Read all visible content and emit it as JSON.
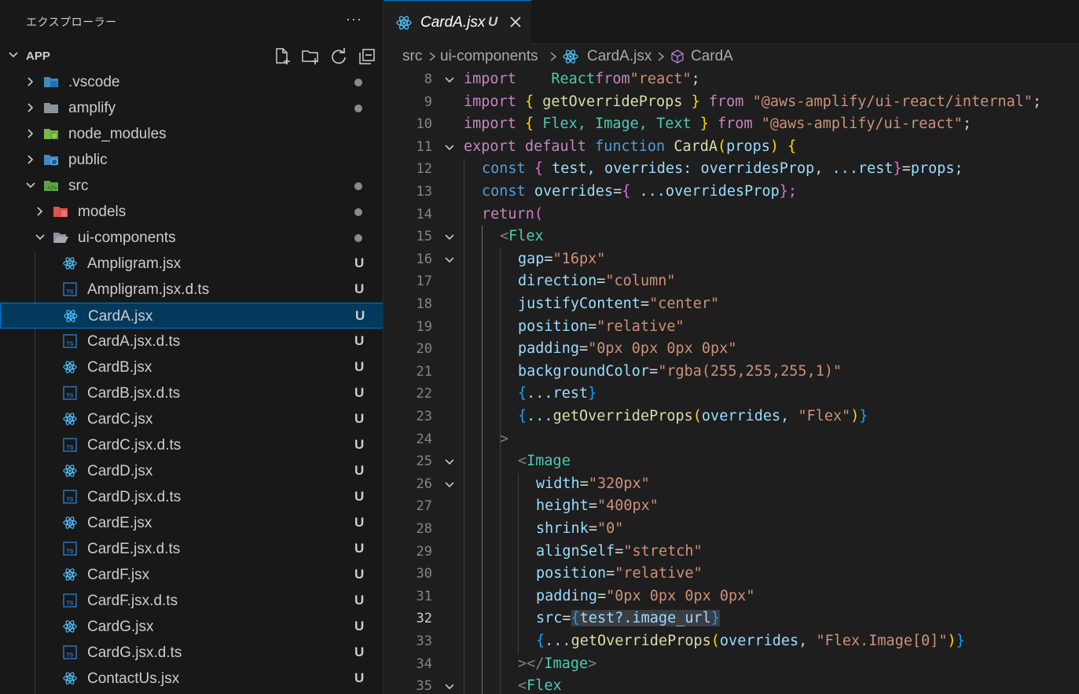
{
  "sidebar": {
    "title": "エクスプローラー",
    "more": "···",
    "section_title": "APP",
    "actions": [
      "new-file-icon",
      "new-folder-icon",
      "refresh-icon",
      "collapse-all-icon"
    ],
    "items": [
      {
        "label": ".vscode",
        "depth": 0,
        "type": "folder",
        "expanded": false,
        "status": "dot",
        "icon": "vscode-folder-icon"
      },
      {
        "label": "amplify",
        "depth": 0,
        "type": "folder",
        "expanded": false,
        "status": "dot",
        "icon": "folder-icon"
      },
      {
        "label": "node_modules",
        "depth": 0,
        "type": "folder",
        "expanded": false,
        "status": "",
        "icon": "node-folder-icon"
      },
      {
        "label": "public",
        "depth": 0,
        "type": "folder",
        "expanded": false,
        "status": "",
        "icon": "public-folder-icon"
      },
      {
        "label": "src",
        "depth": 0,
        "type": "folder",
        "expanded": true,
        "status": "dot",
        "icon": "src-folder-icon"
      },
      {
        "label": "models",
        "depth": 1,
        "type": "folder",
        "expanded": false,
        "status": "dot",
        "icon": "models-folder-icon"
      },
      {
        "label": "ui-components",
        "depth": 1,
        "type": "folder",
        "expanded": true,
        "status": "dot",
        "icon": "open-folder-icon"
      },
      {
        "label": "Ampligram.jsx",
        "depth": 2,
        "type": "jsx",
        "status": "U"
      },
      {
        "label": "Ampligram.jsx.d.ts",
        "depth": 2,
        "type": "ts",
        "status": "U"
      },
      {
        "label": "CardA.jsx",
        "depth": 2,
        "type": "jsx",
        "status": "U",
        "selected": true
      },
      {
        "label": "CardA.jsx.d.ts",
        "depth": 2,
        "type": "ts",
        "status": "U"
      },
      {
        "label": "CardB.jsx",
        "depth": 2,
        "type": "jsx",
        "status": "U"
      },
      {
        "label": "CardB.jsx.d.ts",
        "depth": 2,
        "type": "ts",
        "status": "U"
      },
      {
        "label": "CardC.jsx",
        "depth": 2,
        "type": "jsx",
        "status": "U"
      },
      {
        "label": "CardC.jsx.d.ts",
        "depth": 2,
        "type": "ts",
        "status": "U"
      },
      {
        "label": "CardD.jsx",
        "depth": 2,
        "type": "jsx",
        "status": "U"
      },
      {
        "label": "CardD.jsx.d.ts",
        "depth": 2,
        "type": "ts",
        "status": "U"
      },
      {
        "label": "CardE.jsx",
        "depth": 2,
        "type": "jsx",
        "status": "U"
      },
      {
        "label": "CardE.jsx.d.ts",
        "depth": 2,
        "type": "ts",
        "status": "U"
      },
      {
        "label": "CardF.jsx",
        "depth": 2,
        "type": "jsx",
        "status": "U"
      },
      {
        "label": "CardF.jsx.d.ts",
        "depth": 2,
        "type": "ts",
        "status": "U"
      },
      {
        "label": "CardG.jsx",
        "depth": 2,
        "type": "jsx",
        "status": "U"
      },
      {
        "label": "CardG.jsx.d.ts",
        "depth": 2,
        "type": "ts",
        "status": "U"
      },
      {
        "label": "ContactUs.jsx",
        "depth": 2,
        "type": "jsx",
        "status": "U"
      }
    ]
  },
  "tab": {
    "label": "CardA.jsx",
    "badge": "U"
  },
  "breadcrumb": {
    "part1": "src",
    "part2": "ui-components",
    "part3": "CardA.jsx",
    "part4": "CardA"
  },
  "colors": {
    "accent": "#0078d4",
    "selection": "#04395e",
    "react": "#4fc1ff",
    "ts": "#3178c6"
  },
  "code": {
    "active_line": "32",
    "lines": [
      {
        "n": "8",
        "fold": true,
        "t": [
          [
            "kw",
            "import"
          ],
          [
            "",
            "  "
          ],
          [
            "cls",
            "React"
          ],
          [
            "",
            ""
          ],
          [
            "kw",
            "from"
          ],
          [
            "",
            ""
          ],
          [
            "str",
            "\"react\""
          ],
          [
            "",
            ";"
          ]
        ]
      },
      {
        "n": "9",
        "fold": false,
        "t": [
          [
            "kw",
            "import"
          ],
          [
            "b1",
            "{"
          ],
          [
            "fn",
            "getOverrideProps"
          ],
          [
            "b1",
            "}"
          ],
          [
            "kw",
            "from"
          ],
          [
            "str",
            "\"@aws-amplify/ui-react/internal\""
          ],
          [
            "",
            ";"
          ]
        ]
      },
      {
        "n": "10",
        "fold": false,
        "t": [
          [
            "kw",
            "import"
          ],
          [
            "b1",
            "{"
          ],
          [
            "cls",
            "Flex,"
          ],
          [
            "cls",
            "Image,"
          ],
          [
            "cls",
            "Text"
          ],
          [
            "b1",
            "}"
          ],
          [
            "kw",
            "from"
          ],
          [
            "str",
            "\"@aws-amplify/ui-react\""
          ],
          [
            "",
            ";"
          ]
        ]
      },
      {
        "n": "11",
        "fold": true,
        "t": [
          [
            "kw",
            "export"
          ],
          [
            "kw",
            "default"
          ],
          [
            "kb",
            "function"
          ],
          [
            "fn",
            "CardA"
          ],
          [
            "b1",
            "("
          ],
          [
            "var",
            "props"
          ],
          [
            "b1",
            ")"
          ],
          [
            "b1",
            "{"
          ]
        ]
      },
      {
        "n": "12",
        "fold": false,
        "t": [
          [
            "kb",
            "const"
          ],
          [
            "b2",
            "{"
          ],
          [
            "var",
            "test,"
          ],
          [
            "var",
            "overrides:"
          ],
          [
            "var",
            "overridesProp,"
          ],
          [
            "var",
            "...rest"
          ],
          [
            "b2",
            "}"
          ],
          [
            "",
            "="
          ],
          [
            "var",
            "props;"
          ]
        ]
      },
      {
        "n": "13",
        "fold": false,
        "t": [
          [
            "kb",
            "const"
          ],
          [
            "var",
            "overrides"
          ],
          [
            "",
            "="
          ],
          [
            "b2",
            "{"
          ],
          [
            "var",
            "...overridesProp"
          ],
          [
            "b2",
            "};"
          ]
        ]
      },
      {
        "n": "14",
        "fold": false,
        "t": [
          [
            "kw",
            "return"
          ],
          [
            "b2",
            "("
          ]
        ]
      },
      {
        "n": "15",
        "fold": true,
        "t": [
          [
            "tg",
            "<"
          ],
          [
            "cls",
            "Flex"
          ]
        ]
      },
      {
        "n": "16",
        "fold": true,
        "t": [
          [
            "var",
            "gap"
          ],
          [
            "",
            "="
          ],
          [
            "str",
            "\"16px\""
          ]
        ]
      },
      {
        "n": "17",
        "fold": false,
        "t": [
          [
            "var",
            "direction"
          ],
          [
            "",
            "="
          ],
          [
            "str",
            "\"column\""
          ]
        ]
      },
      {
        "n": "18",
        "fold": false,
        "t": [
          [
            "var",
            "justifyContent"
          ],
          [
            "",
            "="
          ],
          [
            "str",
            "\"center\""
          ]
        ]
      },
      {
        "n": "19",
        "fold": false,
        "t": [
          [
            "var",
            "position"
          ],
          [
            "",
            "="
          ],
          [
            "str",
            "\"relative\""
          ]
        ]
      },
      {
        "n": "20",
        "fold": false,
        "t": [
          [
            "var",
            "padding"
          ],
          [
            "",
            "="
          ],
          [
            "str",
            "\"0px 0px 0px 0px\""
          ]
        ]
      },
      {
        "n": "21",
        "fold": false,
        "t": [
          [
            "var",
            "backgroundColor"
          ],
          [
            "",
            "="
          ],
          [
            "str",
            "\"rgba(255,255,255,1)\""
          ]
        ]
      },
      {
        "n": "22",
        "fold": false,
        "t": [
          [
            "b3",
            "{"
          ],
          [
            "var",
            "...rest"
          ],
          [
            "b3",
            "}"
          ]
        ]
      },
      {
        "n": "23",
        "fold": false,
        "t": [
          [
            "b3",
            "{"
          ],
          [
            "var",
            "..."
          ],
          [
            "fn",
            "getOverrideProps"
          ],
          [
            "b1",
            "("
          ],
          [
            "var",
            "overrides,"
          ],
          [
            "str",
            "\"Flex\""
          ],
          [
            "b1",
            ")"
          ],
          [
            "b3",
            "}"
          ]
        ]
      },
      {
        "n": "24",
        "fold": false,
        "t": [
          [
            "tg",
            ">"
          ]
        ]
      },
      {
        "n": "25",
        "fold": true,
        "t": [
          [
            "tg",
            "<"
          ],
          [
            "cls",
            "Image"
          ]
        ]
      },
      {
        "n": "26",
        "fold": true,
        "t": [
          [
            "var",
            "width"
          ],
          [
            "",
            "="
          ],
          [
            "str",
            "\"320px\""
          ]
        ]
      },
      {
        "n": "27",
        "fold": false,
        "t": [
          [
            "var",
            "height"
          ],
          [
            "",
            "="
          ],
          [
            "str",
            "\"400px\""
          ]
        ]
      },
      {
        "n": "28",
        "fold": false,
        "t": [
          [
            "var",
            "shrink"
          ],
          [
            "",
            "="
          ],
          [
            "str",
            "\"0\""
          ]
        ]
      },
      {
        "n": "29",
        "fold": false,
        "t": [
          [
            "var",
            "alignSelf"
          ],
          [
            "",
            "="
          ],
          [
            "str",
            "\"stretch\""
          ]
        ]
      },
      {
        "n": "30",
        "fold": false,
        "t": [
          [
            "var",
            "position"
          ],
          [
            "",
            "="
          ],
          [
            "str",
            "\"relative\""
          ]
        ]
      },
      {
        "n": "31",
        "fold": false,
        "t": [
          [
            "var",
            "padding"
          ],
          [
            "",
            "="
          ],
          [
            "str",
            "\"0px 0px 0px 0px\""
          ]
        ]
      },
      {
        "n": "32",
        "fold": false,
        "t": [
          [
            "var",
            "src"
          ],
          [
            "",
            "="
          ],
          [
            "b3",
            "{"
          ],
          [
            "var",
            "test?.image_url"
          ],
          [
            "b3",
            "}"
          ]
        ]
      },
      {
        "n": "33",
        "fold": false,
        "t": [
          [
            "b3",
            "{"
          ],
          [
            "var",
            "..."
          ],
          [
            "fn",
            "getOverrideProps"
          ],
          [
            "b1",
            "("
          ],
          [
            "var",
            "overrides,"
          ],
          [
            "str",
            "\"Flex.Image[0]\""
          ],
          [
            "b1",
            ")"
          ],
          [
            "b3",
            "}"
          ]
        ]
      },
      {
        "n": "34",
        "fold": false,
        "t": [
          [
            "tg",
            "></"
          ],
          [
            "cls",
            "Image"
          ],
          [
            "tg",
            ">"
          ]
        ]
      },
      {
        "n": "35",
        "fold": true,
        "t": [
          [
            "tg",
            "<"
          ],
          [
            "cls",
            "Flex"
          ]
        ]
      }
    ]
  }
}
